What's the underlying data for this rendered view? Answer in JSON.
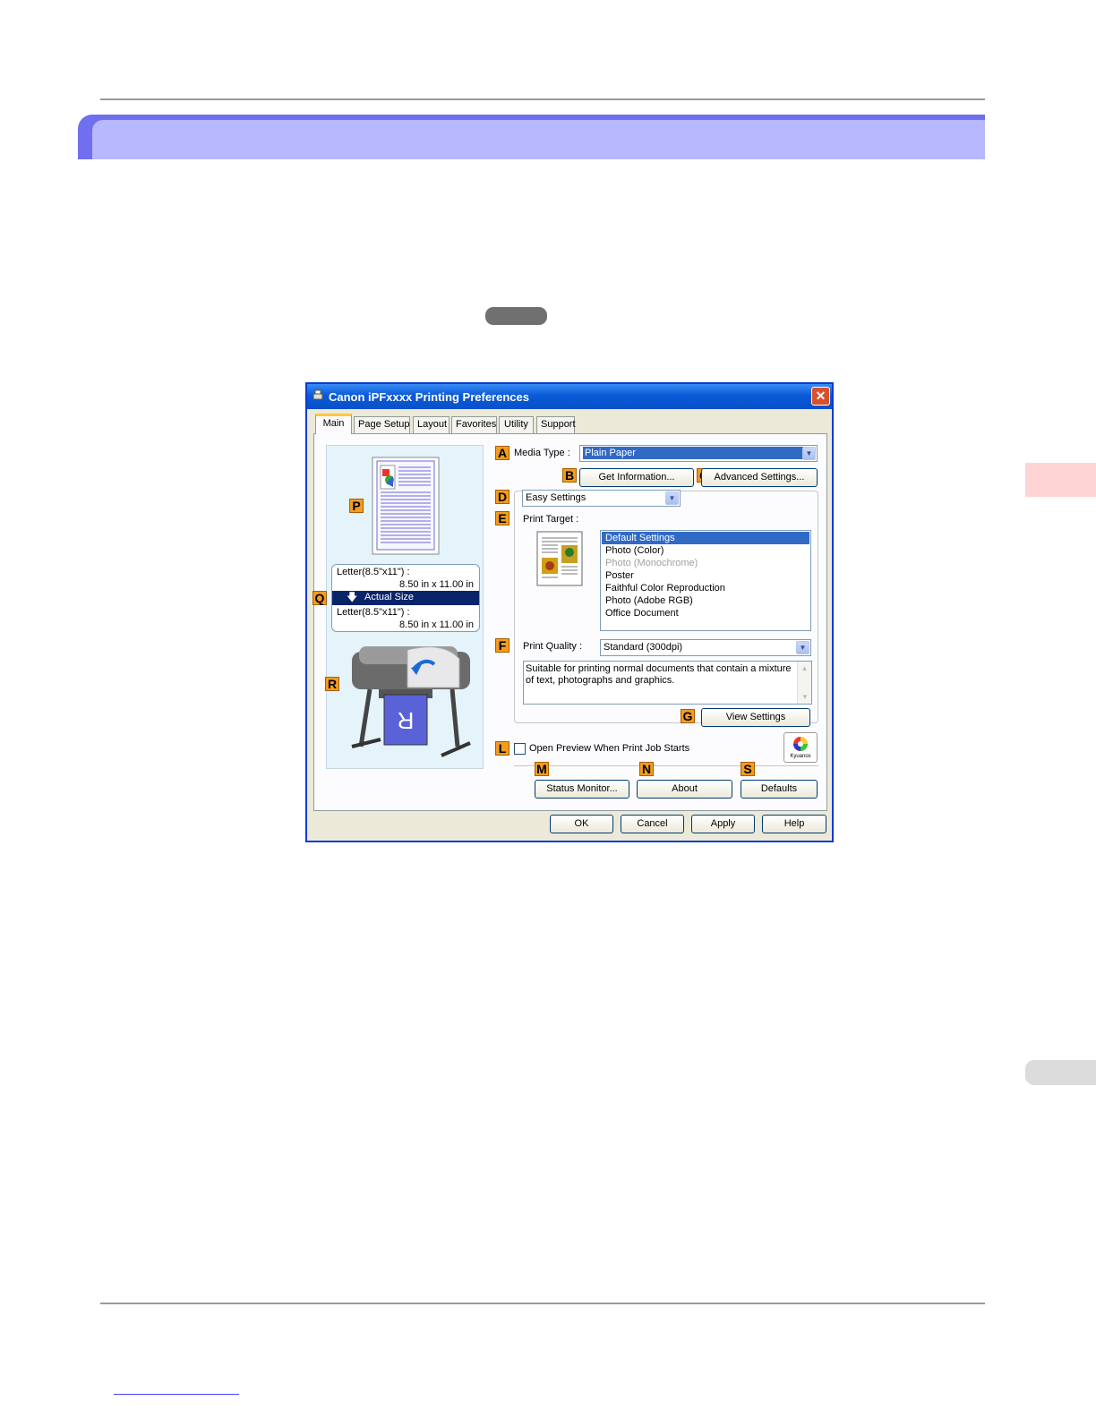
{
  "dialog": {
    "title": "Canon iPFxxxx Printing Preferences",
    "close": "✕",
    "tabs": [
      "Main",
      "Page Setup",
      "Layout",
      "Favorites",
      "Utility",
      "Support"
    ],
    "labels": {
      "A": "A",
      "B": "B",
      "C": "C",
      "D": "D",
      "E": "E",
      "F": "F",
      "G": "G",
      "L": "L",
      "M": "M",
      "N": "N",
      "S": "S",
      "P": "P",
      "Q": "Q",
      "R": "R"
    },
    "media_type_label": "Media Type :",
    "media_type_value": "Plain Paper",
    "get_information": "Get Information...",
    "advanced_settings": "Advanced Settings...",
    "mode_value": "Easy Settings",
    "print_target_label": "Print Target :",
    "print_targets": [
      {
        "text": "Default Settings",
        "state": "selected"
      },
      {
        "text": "Photo (Color)",
        "state": "normal"
      },
      {
        "text": "Photo (Monochrome)",
        "state": "disabled"
      },
      {
        "text": "Poster",
        "state": "normal"
      },
      {
        "text": "Faithful Color Reproduction",
        "state": "normal"
      },
      {
        "text": "Photo (Adobe RGB)",
        "state": "normal"
      },
      {
        "text": "Office Document",
        "state": "normal"
      }
    ],
    "print_quality_label": "Print Quality :",
    "print_quality_value": "Standard (300dpi)",
    "description": "Suitable for printing normal documents that contain a mixture of text, photographs and graphics.",
    "view_settings": "View Settings",
    "open_preview": "Open Preview When Print Job Starts",
    "kyuanos": "Kyuanos",
    "status_monitor": "Status Monitor...",
    "about": "About",
    "defaults": "Defaults",
    "ok": "OK",
    "cancel": "Cancel",
    "apply": "Apply",
    "help": "Help",
    "size_from": "Letter(8.5\"x11\") :",
    "size_from_dims": "8.50 in x 11.00 in",
    "scale": "Actual Size",
    "size_to": "Letter(8.5\"x11\") :",
    "size_to_dims": "8.50 in x 11.00 in",
    "printer_paper_letter": "R"
  },
  "colors": {
    "banner_outer": "#6f6ff0",
    "banner_inner": "#b8b8ff",
    "label_orange": "#f39c1e",
    "selection_blue": "#316ac5",
    "side_tab": "#ffd4d4"
  }
}
